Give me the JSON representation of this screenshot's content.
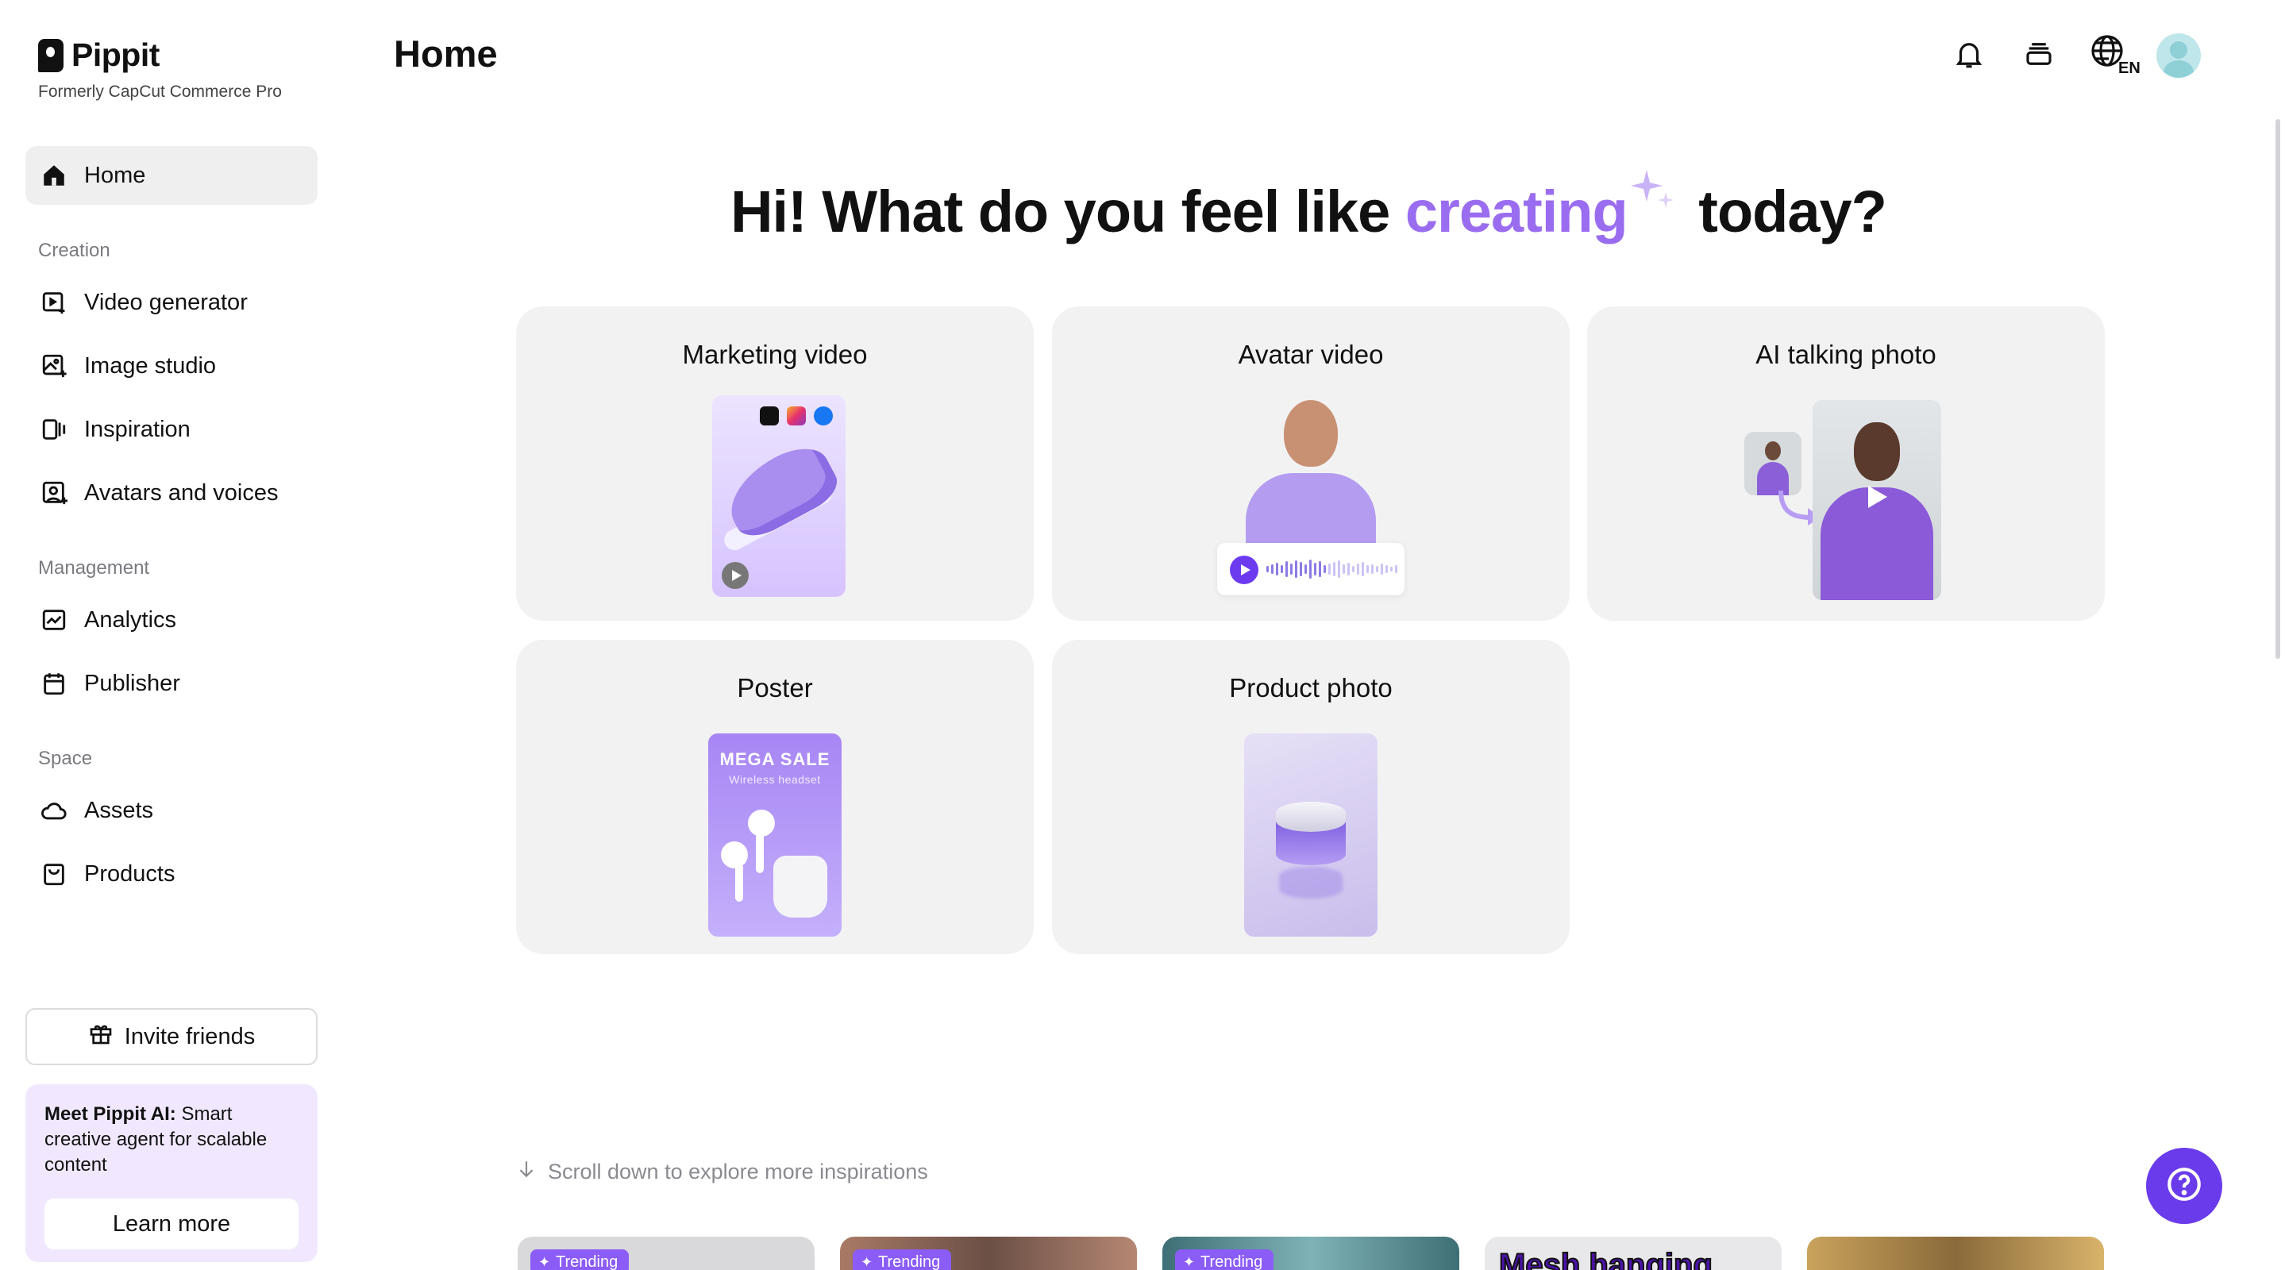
{
  "brand": {
    "name": "Pippit",
    "subtitle": "Formerly CapCut Commerce Pro"
  },
  "sidebar": {
    "home": {
      "label": "Home",
      "icon": "home-icon"
    },
    "sections": [
      {
        "label": "Creation",
        "items": [
          {
            "label": "Video generator",
            "icon": "video-generator-icon"
          },
          {
            "label": "Image studio",
            "icon": "image-studio-icon"
          },
          {
            "label": "Inspiration",
            "icon": "inspiration-icon"
          },
          {
            "label": "Avatars and voices",
            "icon": "avatar-voice-icon"
          }
        ]
      },
      {
        "label": "Management",
        "items": [
          {
            "label": "Analytics",
            "icon": "analytics-icon"
          },
          {
            "label": "Publisher",
            "icon": "calendar-icon"
          }
        ]
      },
      {
        "label": "Space",
        "items": [
          {
            "label": "Assets",
            "icon": "cloud-icon"
          },
          {
            "label": "Products",
            "icon": "bag-icon"
          }
        ]
      }
    ],
    "invite_label": "Invite friends",
    "promo": {
      "bold": "Meet Pippit AI:",
      "text": " Smart creative agent for scalable content",
      "button": "Learn more"
    }
  },
  "header": {
    "title": "Home",
    "language": "EN",
    "icons": [
      "bell-icon",
      "stack-icon",
      "globe-language-icon",
      "avatar"
    ]
  },
  "hero": {
    "prefix": "Hi! What do you feel like ",
    "accent": "creating",
    "suffix": " today?",
    "accent_color": "#9a6df0"
  },
  "cards": [
    {
      "title": "Marketing video"
    },
    {
      "title": "Avatar video"
    },
    {
      "title": "AI talking photo"
    },
    {
      "title": "Poster",
      "poster_headline": "MEGA SALE",
      "poster_sub": "Wireless headset"
    },
    {
      "title": "Product photo"
    }
  ],
  "scroll_hint": "Scroll down to explore more inspirations",
  "inspirations": [
    {
      "badge": "Trending"
    },
    {
      "badge": "Trending"
    },
    {
      "badge": "Trending"
    },
    {
      "caption": "Mesh hanging"
    },
    {
      "caption": ""
    }
  ],
  "colors": {
    "accent": "#6a3bea",
    "active_nav_bg": "#efeff0",
    "card_bg": "#f2f2f3",
    "promo_bg": "#f1e8ff"
  }
}
